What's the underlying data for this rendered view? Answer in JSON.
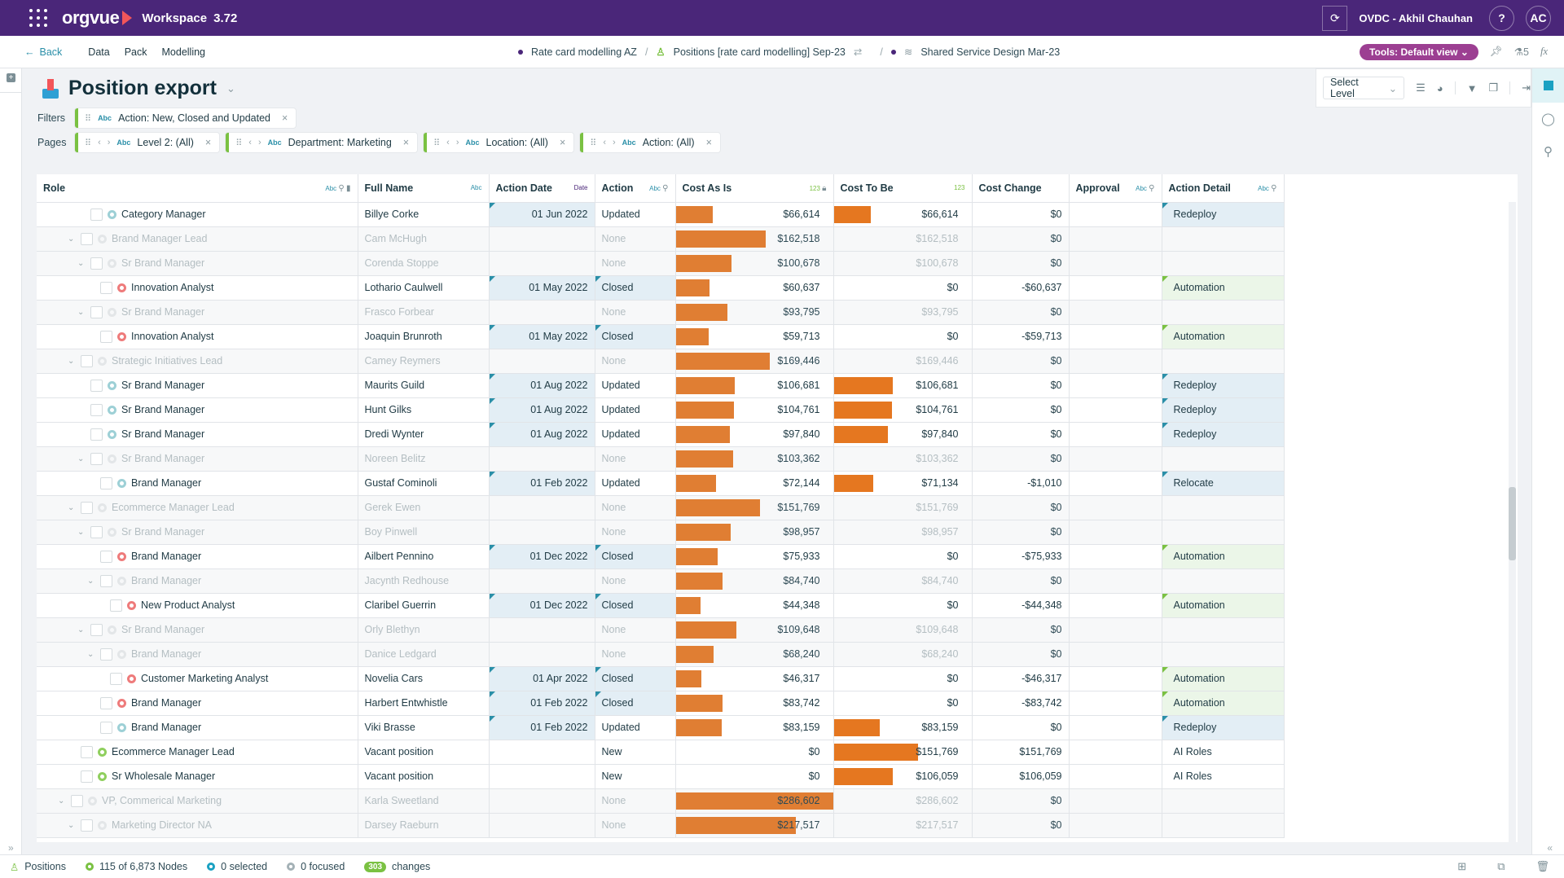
{
  "topbar": {
    "app_name": "orgvue",
    "workspace_label": "Workspace",
    "version": "3.72",
    "user_label": "OVDC - Akhil Chauhan",
    "help_label": "?",
    "avatar_initials": "AC"
  },
  "nav": {
    "back_label": "Back",
    "links": [
      "Data",
      "Pack",
      "Modelling"
    ],
    "breadcrumbs": [
      "Rate card modelling AZ",
      "Positions [rate card modelling] Sep-23",
      "Shared Service Design Mar-23"
    ],
    "tools_label": "Tools: Default view",
    "flask_count": "5",
    "fx_label": "fx"
  },
  "page": {
    "title": "Position export",
    "filters_label": "Filters",
    "pages_label": "Pages",
    "filters": [
      {
        "type": "Abc",
        "label": "Action: New, Closed and Updated"
      }
    ],
    "pages": [
      {
        "type": "Abc",
        "label": "Level 2: (All)"
      },
      {
        "type": "Abc",
        "label": "Department: Marketing"
      },
      {
        "type": "Abc",
        "label": "Location: (All)"
      },
      {
        "type": "Abc",
        "label": "Action: (All)"
      }
    ]
  },
  "toolbox": {
    "select_level": "Select Level"
  },
  "grid": {
    "columns": [
      {
        "label": "Role",
        "tag": "Abc"
      },
      {
        "label": "Full Name",
        "tag": "Abc"
      },
      {
        "label": "Action Date",
        "tag": "Date"
      },
      {
        "label": "Action",
        "tag": "Abc"
      },
      {
        "label": "Cost As Is",
        "tag": "123"
      },
      {
        "label": "Cost To Be",
        "tag": "123"
      },
      {
        "label": "Cost Change",
        "tag": ""
      },
      {
        "label": "Approval",
        "tag": "Abc"
      },
      {
        "label": "Action Detail",
        "tag": "Abc"
      }
    ],
    "max_cost": 286602,
    "rows": [
      {
        "indent": 3,
        "expand": false,
        "dim": false,
        "status": "teal",
        "role": "Category Manager",
        "name": "Billye Corke",
        "date": "01 Jun 2022",
        "action": "Updated",
        "cost_as_is": "$66,614",
        "cost_as_is_value": 66614,
        "cost_to_be": "$66,614",
        "cost_to_be_value": 66614,
        "cost_change": "$0",
        "approval": "",
        "detail": "Redeploy"
      },
      {
        "indent": 2,
        "expand": true,
        "dim": true,
        "status": "grey",
        "role": "Brand Manager Lead",
        "name": "Cam McHugh",
        "date": "",
        "action": "None",
        "cost_as_is": "$162,518",
        "cost_as_is_value": 162518,
        "cost_to_be": "$162,518",
        "cost_to_be_value": 0,
        "cost_change": "$0",
        "approval": "",
        "detail": ""
      },
      {
        "indent": 3,
        "expand": true,
        "dim": true,
        "status": "grey",
        "role": "Sr Brand Manager",
        "name": "Corenda Stoppe",
        "date": "",
        "action": "None",
        "cost_as_is": "$100,678",
        "cost_as_is_value": 100678,
        "cost_to_be": "$100,678",
        "cost_to_be_value": 0,
        "cost_change": "$0",
        "approval": "",
        "detail": ""
      },
      {
        "indent": 4,
        "expand": false,
        "dim": false,
        "status": "red",
        "role": "Innovation Analyst",
        "name": "Lothario Caulwell",
        "date": "01 May 2022",
        "action": "Closed",
        "cost_as_is": "$60,637",
        "cost_as_is_value": 60637,
        "cost_to_be": "$0",
        "cost_to_be_value": 0,
        "cost_change": "-$60,637",
        "approval": "",
        "detail": "Automation"
      },
      {
        "indent": 3,
        "expand": true,
        "dim": true,
        "status": "grey",
        "role": "Sr Brand Manager",
        "name": "Frasco Forbear",
        "date": "",
        "action": "None",
        "cost_as_is": "$93,795",
        "cost_as_is_value": 93795,
        "cost_to_be": "$93,795",
        "cost_to_be_value": 0,
        "cost_change": "$0",
        "approval": "",
        "detail": ""
      },
      {
        "indent": 4,
        "expand": false,
        "dim": false,
        "status": "red",
        "role": "Innovation Analyst",
        "name": "Joaquin Brunroth",
        "date": "01 May 2022",
        "action": "Closed",
        "cost_as_is": "$59,713",
        "cost_as_is_value": 59713,
        "cost_to_be": "$0",
        "cost_to_be_value": 0,
        "cost_change": "-$59,713",
        "approval": "",
        "detail": "Automation"
      },
      {
        "indent": 2,
        "expand": true,
        "dim": true,
        "status": "grey",
        "role": "Strategic Initiatives Lead",
        "name": "Camey Reymers",
        "date": "",
        "action": "None",
        "cost_as_is": "$169,446",
        "cost_as_is_value": 169446,
        "cost_to_be": "$169,446",
        "cost_to_be_value": 0,
        "cost_change": "$0",
        "approval": "",
        "detail": ""
      },
      {
        "indent": 3,
        "expand": false,
        "dim": false,
        "status": "teal",
        "role": "Sr Brand Manager",
        "name": "Maurits Guild",
        "date": "01 Aug 2022",
        "action": "Updated",
        "cost_as_is": "$106,681",
        "cost_as_is_value": 106681,
        "cost_to_be": "$106,681",
        "cost_to_be_value": 106681,
        "cost_change": "$0",
        "approval": "",
        "detail": "Redeploy"
      },
      {
        "indent": 3,
        "expand": false,
        "dim": false,
        "status": "teal",
        "role": "Sr Brand Manager",
        "name": "Hunt Gilks",
        "date": "01 Aug 2022",
        "action": "Updated",
        "cost_as_is": "$104,761",
        "cost_as_is_value": 104761,
        "cost_to_be": "$104,761",
        "cost_to_be_value": 104761,
        "cost_change": "$0",
        "approval": "",
        "detail": "Redeploy"
      },
      {
        "indent": 3,
        "expand": false,
        "dim": false,
        "status": "teal",
        "role": "Sr Brand Manager",
        "name": "Dredi Wynter",
        "date": "01 Aug 2022",
        "action": "Updated",
        "cost_as_is": "$97,840",
        "cost_as_is_value": 97840,
        "cost_to_be": "$97,840",
        "cost_to_be_value": 97840,
        "cost_change": "$0",
        "approval": "",
        "detail": "Redeploy"
      },
      {
        "indent": 3,
        "expand": true,
        "dim": true,
        "status": "grey",
        "role": "Sr Brand Manager",
        "name": "Noreen Belitz",
        "date": "",
        "action": "None",
        "cost_as_is": "$103,362",
        "cost_as_is_value": 103362,
        "cost_to_be": "$103,362",
        "cost_to_be_value": 0,
        "cost_change": "$0",
        "approval": "",
        "detail": ""
      },
      {
        "indent": 4,
        "expand": false,
        "dim": false,
        "status": "teal",
        "role": "Brand Manager",
        "name": "Gustaf Cominoli",
        "date": "01 Feb 2022",
        "action": "Updated",
        "cost_as_is": "$72,144",
        "cost_as_is_value": 72144,
        "cost_to_be": "$71,134",
        "cost_to_be_value": 71134,
        "cost_change": "-$1,010",
        "approval": "",
        "detail": "Relocate"
      },
      {
        "indent": 2,
        "expand": true,
        "dim": true,
        "status": "grey",
        "role": "Ecommerce Manager Lead",
        "name": "Gerek Ewen",
        "date": "",
        "action": "None",
        "cost_as_is": "$151,769",
        "cost_as_is_value": 151769,
        "cost_to_be": "$151,769",
        "cost_to_be_value": 0,
        "cost_change": "$0",
        "approval": "",
        "detail": ""
      },
      {
        "indent": 3,
        "expand": true,
        "dim": true,
        "status": "grey",
        "role": "Sr Brand Manager",
        "name": "Boy Pinwell",
        "date": "",
        "action": "None",
        "cost_as_is": "$98,957",
        "cost_as_is_value": 98957,
        "cost_to_be": "$98,957",
        "cost_to_be_value": 0,
        "cost_change": "$0",
        "approval": "",
        "detail": ""
      },
      {
        "indent": 4,
        "expand": false,
        "dim": false,
        "status": "red",
        "role": "Brand Manager",
        "name": "Ailbert Pennino",
        "date": "01 Dec 2022",
        "action": "Closed",
        "cost_as_is": "$75,933",
        "cost_as_is_value": 75933,
        "cost_to_be": "$0",
        "cost_to_be_value": 0,
        "cost_change": "-$75,933",
        "approval": "",
        "detail": "Automation"
      },
      {
        "indent": 4,
        "expand": true,
        "dim": true,
        "status": "grey",
        "role": "Brand Manager",
        "name": "Jacynth Redhouse",
        "date": "",
        "action": "None",
        "cost_as_is": "$84,740",
        "cost_as_is_value": 84740,
        "cost_to_be": "$84,740",
        "cost_to_be_value": 0,
        "cost_change": "$0",
        "approval": "",
        "detail": ""
      },
      {
        "indent": 5,
        "expand": false,
        "dim": false,
        "status": "red",
        "role": "New Product Analyst",
        "name": "Claribel Guerrin",
        "date": "01 Dec 2022",
        "action": "Closed",
        "cost_as_is": "$44,348",
        "cost_as_is_value": 44348,
        "cost_to_be": "$0",
        "cost_to_be_value": 0,
        "cost_change": "-$44,348",
        "approval": "",
        "detail": "Automation"
      },
      {
        "indent": 3,
        "expand": true,
        "dim": true,
        "status": "grey",
        "role": "Sr Brand Manager",
        "name": "Orly Blethyn",
        "date": "",
        "action": "None",
        "cost_as_is": "$109,648",
        "cost_as_is_value": 109648,
        "cost_to_be": "$109,648",
        "cost_to_be_value": 0,
        "cost_change": "$0",
        "approval": "",
        "detail": ""
      },
      {
        "indent": 4,
        "expand": true,
        "dim": true,
        "status": "grey",
        "role": "Brand Manager",
        "name": "Danice Ledgard",
        "date": "",
        "action": "None",
        "cost_as_is": "$68,240",
        "cost_as_is_value": 68240,
        "cost_to_be": "$68,240",
        "cost_to_be_value": 0,
        "cost_change": "$0",
        "approval": "",
        "detail": ""
      },
      {
        "indent": 5,
        "expand": false,
        "dim": false,
        "status": "red",
        "role": "Customer Marketing Analyst",
        "name": "Novelia Cars",
        "date": "01 Apr 2022",
        "action": "Closed",
        "cost_as_is": "$46,317",
        "cost_as_is_value": 46317,
        "cost_to_be": "$0",
        "cost_to_be_value": 0,
        "cost_change": "-$46,317",
        "approval": "",
        "detail": "Automation"
      },
      {
        "indent": 4,
        "expand": false,
        "dim": false,
        "status": "red",
        "role": "Brand Manager",
        "name": "Harbert Entwhistle",
        "date": "01 Feb 2022",
        "action": "Closed",
        "cost_as_is": "$83,742",
        "cost_as_is_value": 83742,
        "cost_to_be": "$0",
        "cost_to_be_value": 0,
        "cost_change": "-$83,742",
        "approval": "",
        "detail": "Automation"
      },
      {
        "indent": 4,
        "expand": false,
        "dim": false,
        "status": "teal",
        "role": "Brand Manager",
        "name": "Viki Brasse",
        "date": "01 Feb 2022",
        "action": "Updated",
        "cost_as_is": "$83,159",
        "cost_as_is_value": 83159,
        "cost_to_be": "$83,159",
        "cost_to_be_value": 83159,
        "cost_change": "$0",
        "approval": "",
        "detail": "Redeploy"
      },
      {
        "indent": 2,
        "expand": false,
        "dim": false,
        "status": "green",
        "role": "Ecommerce Manager Lead",
        "name": "Vacant position",
        "date": "",
        "action": "New",
        "cost_as_is": "$0",
        "cost_as_is_value": 0,
        "cost_to_be": "$151,769",
        "cost_to_be_value": 151769,
        "cost_change": "$151,769",
        "approval": "",
        "detail": "AI Roles"
      },
      {
        "indent": 2,
        "expand": false,
        "dim": false,
        "status": "green",
        "role": "Sr Wholesale Manager",
        "name": "Vacant position",
        "date": "",
        "action": "New",
        "cost_as_is": "$0",
        "cost_as_is_value": 0,
        "cost_to_be": "$106,059",
        "cost_to_be_value": 106059,
        "cost_change": "$106,059",
        "approval": "",
        "detail": "AI Roles"
      },
      {
        "indent": 1,
        "expand": true,
        "dim": true,
        "status": "grey",
        "role": "VP, Commerical Marketing",
        "name": "Karla Sweetland",
        "date": "",
        "action": "None",
        "cost_as_is": "$286,602",
        "cost_as_is_value": 286602,
        "cost_to_be": "$286,602",
        "cost_to_be_value": 0,
        "cost_change": "$0",
        "approval": "",
        "detail": ""
      },
      {
        "indent": 2,
        "expand": true,
        "dim": true,
        "status": "grey",
        "role": "Marketing Director NA",
        "name": "Darsey Raeburn",
        "date": "",
        "action": "None",
        "cost_as_is": "$217,517",
        "cost_as_is_value": 217517,
        "cost_to_be": "$217,517",
        "cost_to_be_value": 0,
        "cost_change": "$0",
        "approval": "",
        "detail": ""
      }
    ]
  },
  "footer": {
    "dataset_label": "Positions",
    "nodes_label": "115 of 6,873 Nodes",
    "selected_label": "0 selected",
    "focused_label": "0 focused",
    "changes_count": "303",
    "changes_label": "changes"
  }
}
